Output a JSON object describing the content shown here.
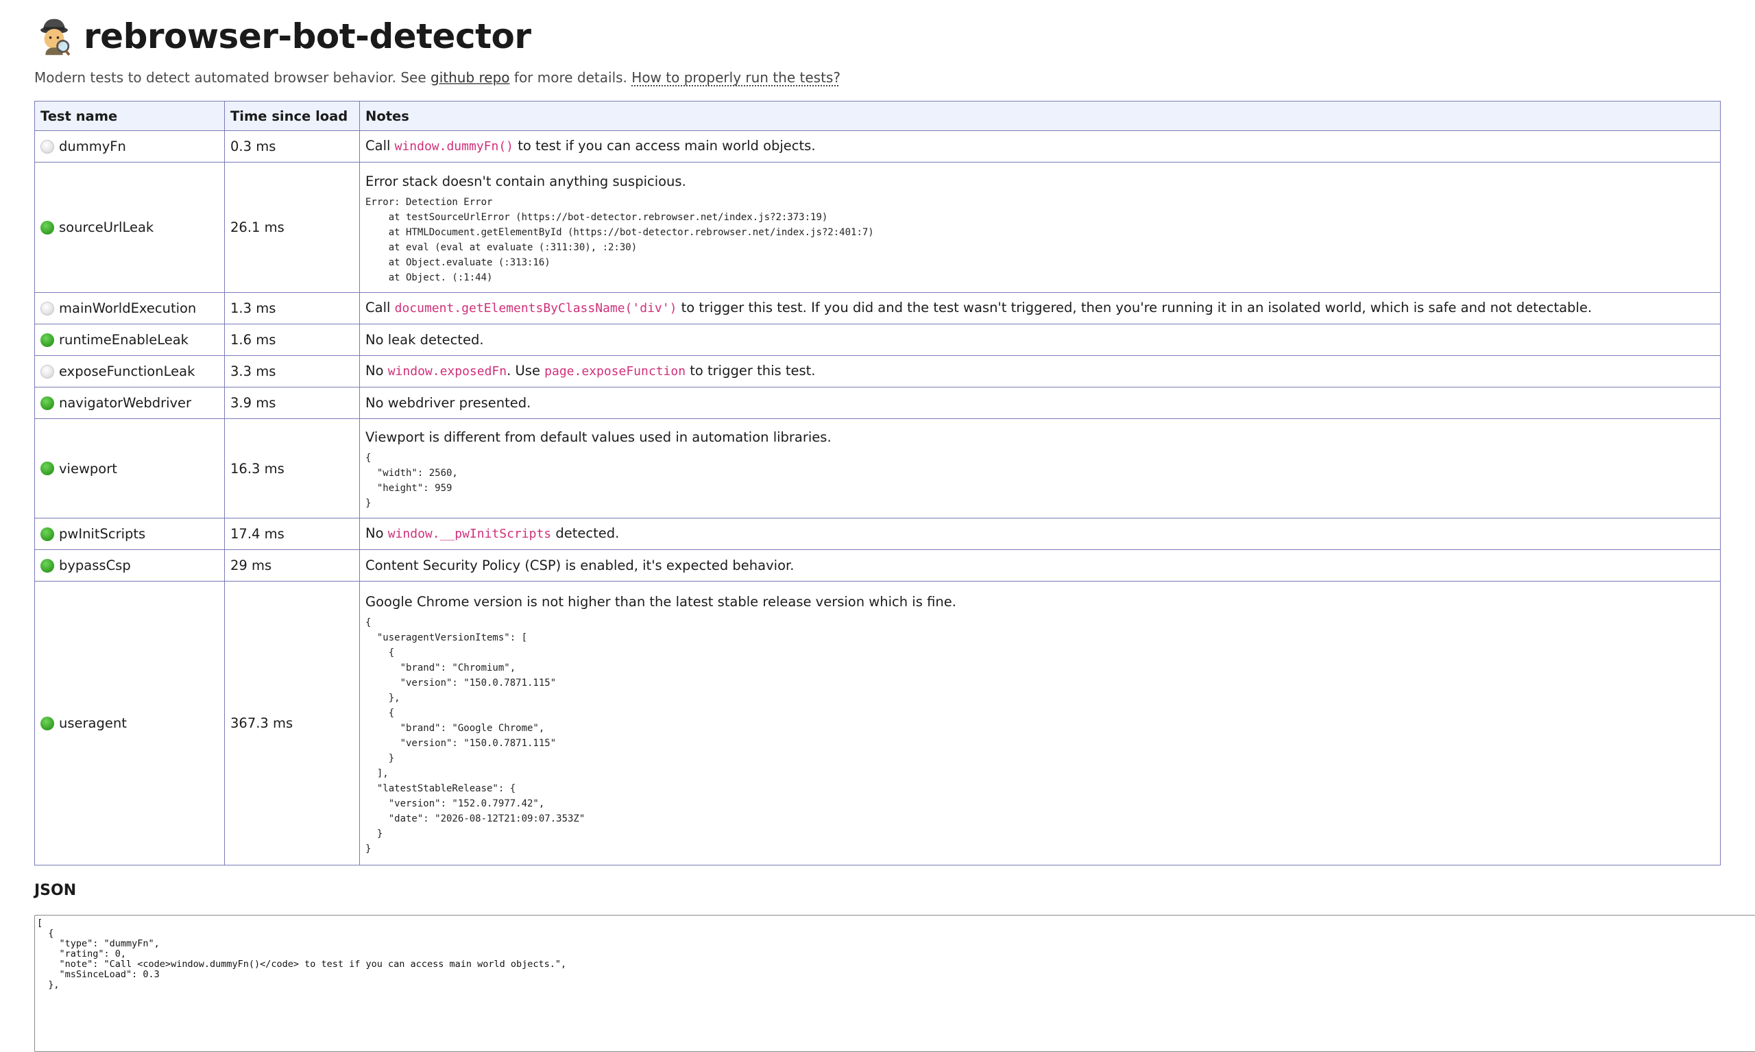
{
  "header": {
    "title": "rebrowser-bot-detector",
    "subtitle_prefix": "Modern tests to detect automated browser behavior. See ",
    "github_link": "github repo",
    "subtitle_middle": " for more details. ",
    "howto_link": "How to properly run the tests?"
  },
  "table": {
    "headers": [
      "Test name",
      "Time since load",
      "Notes"
    ],
    "rows": [
      {
        "status": "white",
        "name": "dummyFn",
        "time": "0.3 ms",
        "note_pre": "Call ",
        "note_code": "window.dummyFn()",
        "note_post": " to test if you can access main world objects."
      },
      {
        "status": "green",
        "name": "sourceUrlLeak",
        "time": "26.1 ms",
        "note": "Error stack doesn't contain anything suspicious.",
        "block": "Error: Detection Error\n    at testSourceUrlError (https://bot-detector.rebrowser.net/index.js?2:373:19)\n    at HTMLDocument.getElementById (https://bot-detector.rebrowser.net/index.js?2:401:7)\n    at eval (eval at evaluate (:311:30), :2:30)\n    at Object.evaluate (:313:16)\n    at Object. (:1:44)"
      },
      {
        "status": "white",
        "name": "mainWorldExecution",
        "time": "1.3 ms",
        "note_pre": "Call ",
        "note_code": "document.getElementsByClassName('div')",
        "note_post": " to trigger this test. If you did and the test wasn't triggered, then you're running it in an isolated world, which is safe and not detectable."
      },
      {
        "status": "green",
        "name": "runtimeEnableLeak",
        "time": "1.6 ms",
        "note": "No leak detected."
      },
      {
        "status": "white",
        "name": "exposeFunctionLeak",
        "time": "3.3 ms",
        "note_pre": "No ",
        "note_code": "window.exposedFn",
        "note_mid": ". Use ",
        "note_code2": "page.exposeFunction",
        "note_post": " to trigger this test."
      },
      {
        "status": "green",
        "name": "navigatorWebdriver",
        "time": "3.9 ms",
        "note": "No webdriver presented."
      },
      {
        "status": "green",
        "name": "viewport",
        "time": "16.3 ms",
        "note": "Viewport is different from default values used in automation libraries.",
        "block": "{\n  \"width\": 2560,\n  \"height\": 959\n}"
      },
      {
        "status": "green",
        "name": "pwInitScripts",
        "time": "17.4 ms",
        "note_pre": "No ",
        "note_code": "window.__pwInitScripts",
        "note_post": " detected."
      },
      {
        "status": "green",
        "name": "bypassCsp",
        "time": "29 ms",
        "note": "Content Security Policy (CSP) is enabled, it's expected behavior."
      },
      {
        "status": "green",
        "name": "useragent",
        "time": "367.3 ms",
        "note": "Google Chrome version is not higher than the latest stable release version which is fine.",
        "block": "{\n  \"useragentVersionItems\": [\n    {\n      \"brand\": \"Chromium\",\n      \"version\": \"150.0.7871.115\"\n    },\n    {\n      \"brand\": \"Google Chrome\",\n      \"version\": \"150.0.7871.115\"\n    }\n  ],\n  \"latestStableRelease\": {\n    \"version\": \"152.0.7977.42\",\n    \"date\": \"2026-08-12T21:09:07.353Z\"\n  }\n}"
      }
    ]
  },
  "json_section": {
    "heading": "JSON",
    "content": "[\n  {\n    \"type\": \"dummyFn\",\n    \"rating\": 0,\n    \"note\": \"Call <code>window.dummyFn()</code> to test if you can access main world objects.\",\n    \"msSinceLoad\": 0.3\n  },"
  }
}
